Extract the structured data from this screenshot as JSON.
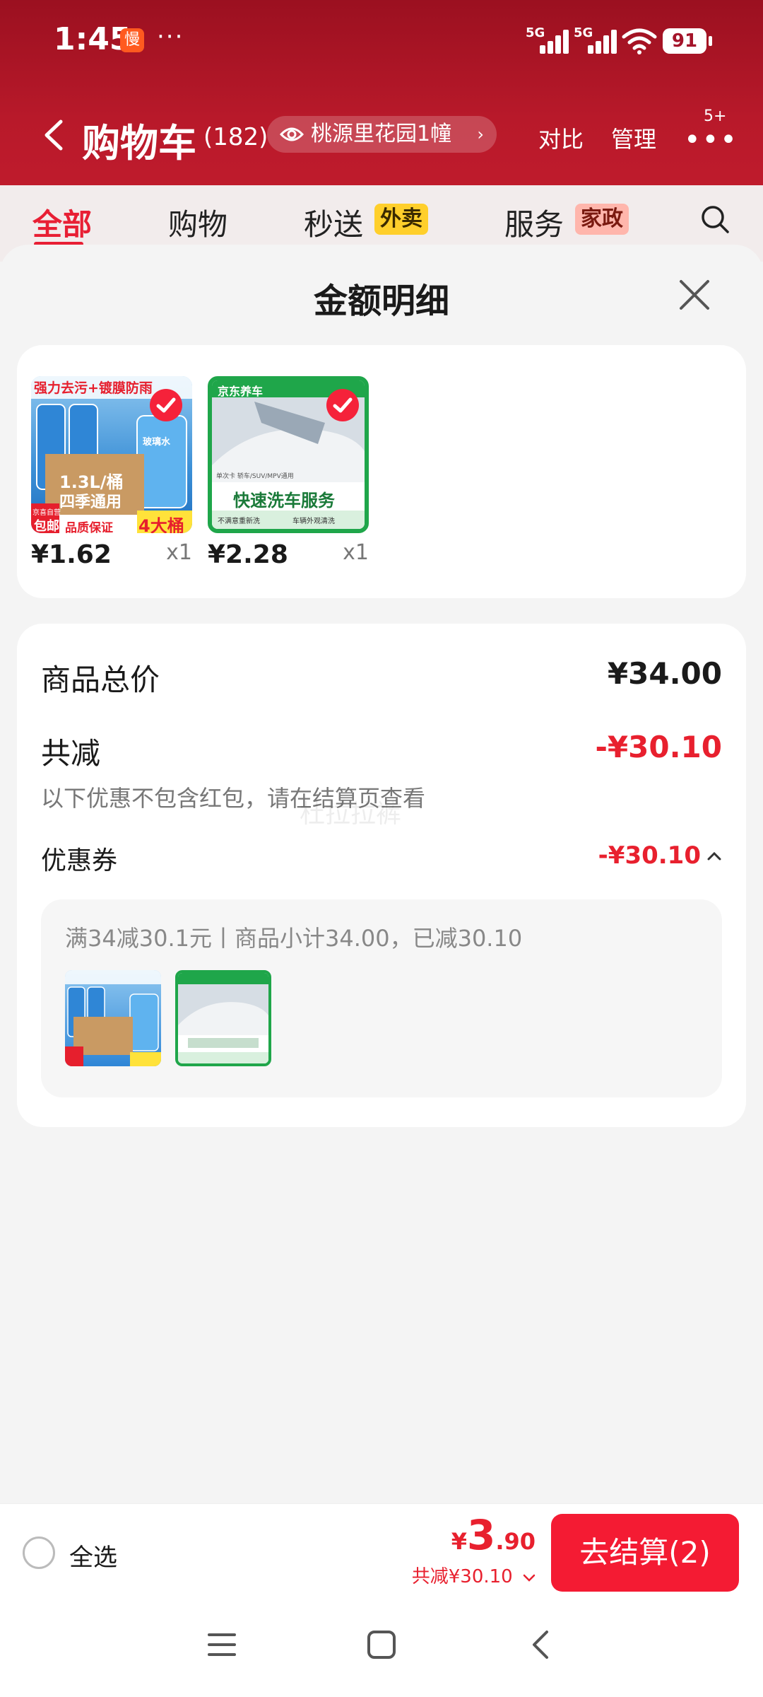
{
  "status": {
    "time": "1:45",
    "app_badge": "慢",
    "dots": "···",
    "sim1": "5G",
    "sim2": "5G",
    "battery": "91"
  },
  "header": {
    "title": "购物车",
    "count": "(182)",
    "address": "桃源里花园1幢",
    "compare": "对比",
    "manage": "管理",
    "more_badge": "5+"
  },
  "tabs": [
    {
      "label": "全部"
    },
    {
      "label": "购物"
    },
    {
      "label": "秒送",
      "tag": "外卖"
    },
    {
      "label": "服务",
      "tag": "家政"
    }
  ],
  "sheet": {
    "title": "金额明细",
    "items": [
      {
        "price": "¥1.62",
        "qty": "x1",
        "thumb": {
          "top": "强力去污+镀膜防雨",
          "mid": "1.3L/桶",
          "mid2": "四季通用",
          "corner": "京喜自营",
          "corner2": "包邮",
          "bottom": "品质保证",
          "badge": "4大桶",
          "brand": "玻璃水"
        }
      },
      {
        "price": "¥2.28",
        "qty": "x1",
        "thumb": {
          "brand": "京东养车",
          "sub": "单次卡 轿车/SUV/MPV通用",
          "title": "快速洗车服务",
          "foot1": "不满意重新洗",
          "foot2": "车辆外观清洗"
        }
      }
    ],
    "summary": {
      "total_label": "商品总价",
      "total_value": "¥34.00",
      "discount_label": "共减",
      "discount_value": "-¥30.10",
      "note": "以下优惠不包含红包，请在结算页查看",
      "coupon_label": "优惠券",
      "coupon_value": "-¥30.10",
      "coupon_detail": "满34减30.1元丨商品小计34.00，已减30.10"
    },
    "watermark": "杜拉拉裤"
  },
  "bottom": {
    "select_all": "全选",
    "currency": "¥",
    "total_int": "3",
    "total_dec": ".90",
    "saved": "共减¥30.10",
    "checkout": "去结算(2)"
  },
  "colors": {
    "brand_red": "#e8202e",
    "header_red": "#b8192a",
    "checkout_red": "#f41b33"
  }
}
